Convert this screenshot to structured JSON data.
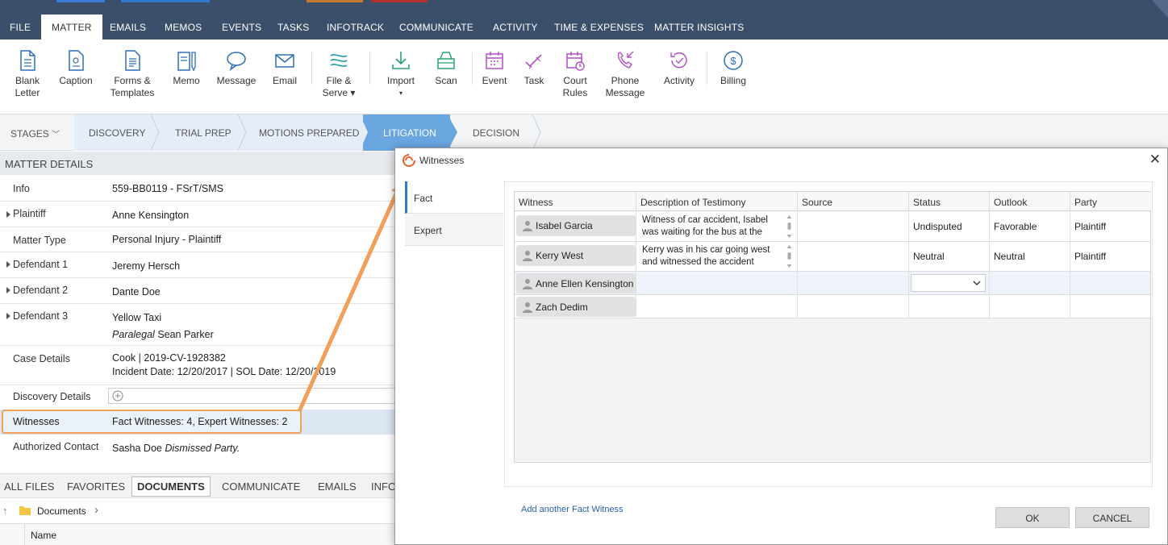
{
  "menu": {
    "tabs": [
      "FILE",
      "MATTER",
      "EMAILS",
      "MEMOS",
      "EVENTS",
      "TASKS",
      "INFOTRACK",
      "COMMUNICATE",
      "ACTIVITY",
      "TIME & EXPENSES",
      "MATTER INSIGHTS"
    ],
    "active": "MATTER"
  },
  "ribbon": [
    {
      "l1": "Blank",
      "l2": "Letter",
      "icon": "blank-letter-icon"
    },
    {
      "l1": "Caption",
      "l2": "",
      "icon": "caption-icon"
    },
    {
      "l1": "Forms &",
      "l2": "Templates",
      "icon": "forms-icon"
    },
    {
      "l1": "Memo",
      "l2": "",
      "icon": "memo-icon"
    },
    {
      "l1": "Message",
      "l2": "",
      "icon": "message-icon"
    },
    {
      "l1": "Email",
      "l2": "",
      "icon": "email-icon"
    },
    {
      "l1": "File &",
      "l2": "Serve ▾",
      "icon": "file-serve-icon"
    },
    {
      "l1": "Import",
      "l2": "▾",
      "icon": "import-icon"
    },
    {
      "l1": "Scan",
      "l2": "",
      "icon": "scan-icon"
    },
    {
      "l1": "Event",
      "l2": "",
      "icon": "event-icon"
    },
    {
      "l1": "Task",
      "l2": "",
      "icon": "task-icon"
    },
    {
      "l1": "Court",
      "l2": "Rules",
      "icon": "court-rules-icon"
    },
    {
      "l1": "Phone",
      "l2": "Message",
      "icon": "phone-message-icon"
    },
    {
      "l1": "Activity",
      "l2": "",
      "icon": "activity-icon"
    },
    {
      "l1": "Billing",
      "l2": "",
      "icon": "billing-icon"
    }
  ],
  "stages": {
    "label": "STAGES",
    "items": [
      "DISCOVERY",
      "TRIAL PREP",
      "MOTIONS PREPARED",
      "LITIGATION",
      "DECISION"
    ],
    "active": "LITIGATION"
  },
  "matter_details": {
    "header": "MATTER DETAILS",
    "info_label": "Info",
    "info_value": "559-BB0119 - FSrT/SMS",
    "plaintiff_label": "Plaintiff",
    "plaintiff_value": "Anne Kensington",
    "matter_type_label": "Matter Type",
    "matter_type_value": "Personal Injury - Plaintiff",
    "def1_label": "Defendant 1",
    "def1_value": "Jeremy Hersch",
    "def2_label": "Defendant 2",
    "def2_value": "Dante Doe",
    "def3_label": "Defendant 3",
    "def3_value": "Yellow Taxi",
    "def3_sub_role": "Paralegal",
    "def3_sub_name": "Sean Parker",
    "case_label": "Case Details",
    "case_line1": "Cook | 2019-CV-1928382",
    "case_line2": "Incident Date: 12/20/2017 | SOL Date: 12/20/2019",
    "discovery_label": "Discovery Details",
    "witnesses_label": "Witnesses",
    "witnesses_value": "Fact Witnesses: 4, Expert Witnesses: 2",
    "auth_label": "Authorized Contact",
    "auth_value": "Sasha Doe",
    "auth_note": "Dismissed Party."
  },
  "bottom_tabs": {
    "items": [
      "ALL FILES",
      "FAVORITES",
      "DOCUMENTS",
      "COMMUNICATE",
      "EMAILS",
      "INFO"
    ],
    "active": "DOCUMENTS",
    "breadcrumb": "Documents",
    "name_header": "Name"
  },
  "dialog": {
    "title": "Witnesses",
    "tabs": [
      "Fact",
      "Expert"
    ],
    "active_tab": "Fact",
    "columns": [
      "Witness",
      "Description of Testimony",
      "Source",
      "Status",
      "Outlook",
      "Party"
    ],
    "rows": [
      {
        "witness": "Isabel Garcia",
        "description": "Witness of car accident, Isabel was waiting for the bus at the",
        "source": "",
        "status": "Undisputed",
        "outlook": "Favorable",
        "party": "Plaintiff"
      },
      {
        "witness": "Kerry West",
        "description": "Kerry was in his car going west and witnessed the accident",
        "source": "",
        "status": "Neutral",
        "outlook": "Neutral",
        "party": "Plaintiff"
      },
      {
        "witness": "Anne Ellen Kensington",
        "description": "",
        "source": "",
        "status": "",
        "outlook": "",
        "party": ""
      },
      {
        "witness": "Zach Dedim",
        "description": "",
        "source": "",
        "status": "",
        "outlook": "",
        "party": ""
      }
    ],
    "add_link": "Add another Fact Witness",
    "ok": "OK",
    "cancel": "CANCEL"
  },
  "colors": {
    "accent": "#6aa6e0",
    "callout": "#f0a05a",
    "menubar": "#3b4f6b"
  }
}
